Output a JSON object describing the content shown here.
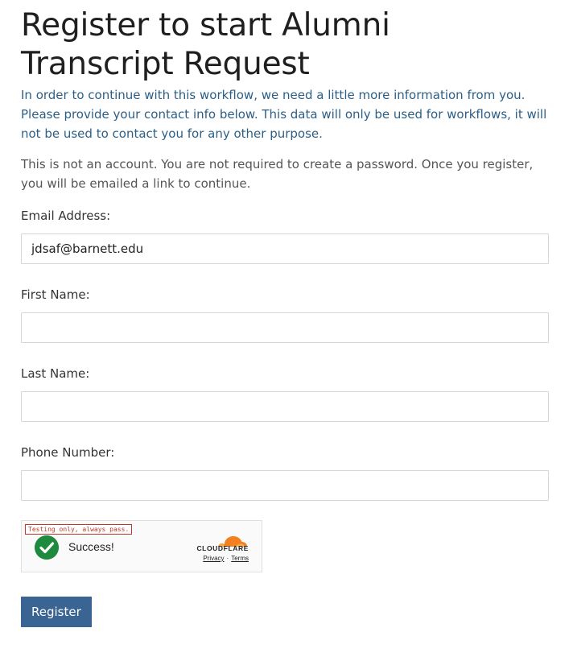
{
  "page": {
    "title": "Register to start Alumni Transcript Request",
    "intro": "In order to continue with this workflow, we need a little more information from you. Please provide your contact info below. This data will only be used for workflows, it will not be used to contact you for any other purpose.",
    "note": "This is not an account. You are not required to create a password. Once you register, you will be emailed a link to continue."
  },
  "form": {
    "email": {
      "label": "Email Address:",
      "value": "jdsaf@barnett.edu"
    },
    "first_name": {
      "label": "First Name:",
      "value": ""
    },
    "last_name": {
      "label": "Last Name:",
      "value": ""
    },
    "phone": {
      "label": "Phone Number:",
      "value": ""
    },
    "submit_label": "Register"
  },
  "captcha": {
    "test_notice": "Testing only, always pass.",
    "status": "Success!",
    "status_icon": "check-circle-icon",
    "brand": "CLOUDFLARE",
    "privacy_link": "Privacy",
    "separator": "·",
    "terms_link": "Terms"
  },
  "colors": {
    "intro_text": "#2b5f87",
    "button": "#3a6592",
    "success_green": "#1e8a3e",
    "cloudflare_orange": "#f48120"
  }
}
